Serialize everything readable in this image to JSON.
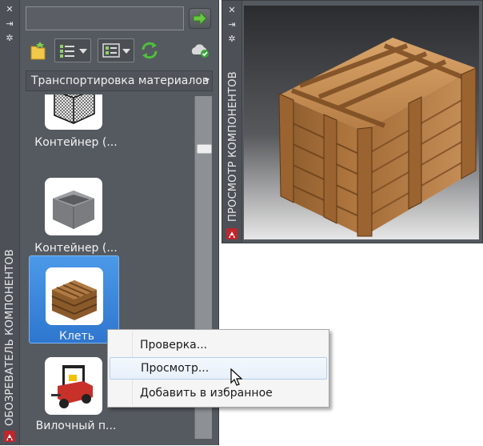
{
  "component_browser": {
    "title": "ОБОЗРЕВАТЕЛЬ КОМПОНЕНТОВ",
    "search": {
      "value": "",
      "placeholder": ""
    },
    "category": "Транспортировка материалов",
    "items": [
      {
        "label": "Контейнер (...",
        "icon": "wire-container-icon",
        "selected": false
      },
      {
        "label": "Контейнер (...",
        "icon": "solid-container-icon",
        "selected": false
      },
      {
        "label": "Клеть",
        "icon": "crate-icon",
        "selected": true
      },
      {
        "label": "Вилочный п...",
        "icon": "forklift-icon",
        "selected": false
      }
    ]
  },
  "component_preview": {
    "title": "ПРОСМОТР КОМПОНЕНТОВ"
  },
  "context_menu": {
    "items": [
      {
        "label": "Проверка..."
      },
      {
        "label": "Просмотр...",
        "hover": true
      },
      {
        "label": "Добавить в избранное"
      }
    ]
  },
  "colors": {
    "selection": "#3a86dc",
    "panel": "#555a60",
    "logo": "#c0262c"
  }
}
